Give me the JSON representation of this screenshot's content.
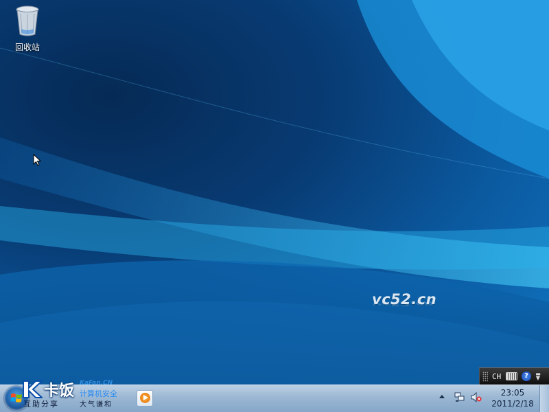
{
  "desktop": {
    "icons": [
      {
        "label": "回收站",
        "icon": "recycle-bin-icon"
      }
    ],
    "watermark": "vc52.cn"
  },
  "language_bar": {
    "language": "CH",
    "keyboard_icon": "keyboard-icon",
    "help_icon": "help-icon",
    "help_glyph": "?"
  },
  "taskbar": {
    "start_icon": "windows-start-icon",
    "logo": {
      "name": "卡饭",
      "sub1": "互助分享",
      "url": "KaFan.CN",
      "tagline": "计算机安全",
      "sub2": "大气谦和"
    },
    "quick_launch": [
      {
        "name": "windows-media-player-icon"
      }
    ],
    "tray": {
      "icons": [
        "show-hidden-icons-icon",
        "network-icon",
        "volume-muted-icon"
      ]
    },
    "clock": {
      "time": "23:05",
      "date": "2011/2/18"
    }
  },
  "colors": {
    "desktop_dark": "#062a55",
    "desktop_light": "#1177c4",
    "taskbar": "#9bb7d3"
  }
}
